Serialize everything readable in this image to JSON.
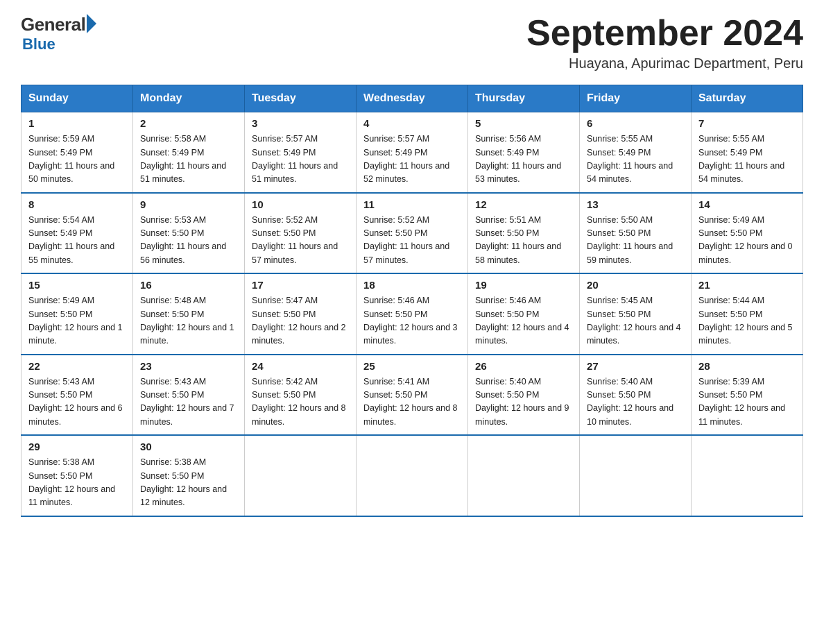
{
  "header": {
    "logo_general": "General",
    "logo_blue": "Blue",
    "month_title": "September 2024",
    "location": "Huayana, Apurimac Department, Peru"
  },
  "days_of_week": [
    "Sunday",
    "Monday",
    "Tuesday",
    "Wednesday",
    "Thursday",
    "Friday",
    "Saturday"
  ],
  "weeks": [
    [
      {
        "day": "1",
        "sunrise": "5:59 AM",
        "sunset": "5:49 PM",
        "daylight": "11 hours and 50 minutes."
      },
      {
        "day": "2",
        "sunrise": "5:58 AM",
        "sunset": "5:49 PM",
        "daylight": "11 hours and 51 minutes."
      },
      {
        "day": "3",
        "sunrise": "5:57 AM",
        "sunset": "5:49 PM",
        "daylight": "11 hours and 51 minutes."
      },
      {
        "day": "4",
        "sunrise": "5:57 AM",
        "sunset": "5:49 PM",
        "daylight": "11 hours and 52 minutes."
      },
      {
        "day": "5",
        "sunrise": "5:56 AM",
        "sunset": "5:49 PM",
        "daylight": "11 hours and 53 minutes."
      },
      {
        "day": "6",
        "sunrise": "5:55 AM",
        "sunset": "5:49 PM",
        "daylight": "11 hours and 54 minutes."
      },
      {
        "day": "7",
        "sunrise": "5:55 AM",
        "sunset": "5:49 PM",
        "daylight": "11 hours and 54 minutes."
      }
    ],
    [
      {
        "day": "8",
        "sunrise": "5:54 AM",
        "sunset": "5:49 PM",
        "daylight": "11 hours and 55 minutes."
      },
      {
        "day": "9",
        "sunrise": "5:53 AM",
        "sunset": "5:50 PM",
        "daylight": "11 hours and 56 minutes."
      },
      {
        "day": "10",
        "sunrise": "5:52 AM",
        "sunset": "5:50 PM",
        "daylight": "11 hours and 57 minutes."
      },
      {
        "day": "11",
        "sunrise": "5:52 AM",
        "sunset": "5:50 PM",
        "daylight": "11 hours and 57 minutes."
      },
      {
        "day": "12",
        "sunrise": "5:51 AM",
        "sunset": "5:50 PM",
        "daylight": "11 hours and 58 minutes."
      },
      {
        "day": "13",
        "sunrise": "5:50 AM",
        "sunset": "5:50 PM",
        "daylight": "11 hours and 59 minutes."
      },
      {
        "day": "14",
        "sunrise": "5:49 AM",
        "sunset": "5:50 PM",
        "daylight": "12 hours and 0 minutes."
      }
    ],
    [
      {
        "day": "15",
        "sunrise": "5:49 AM",
        "sunset": "5:50 PM",
        "daylight": "12 hours and 1 minute."
      },
      {
        "day": "16",
        "sunrise": "5:48 AM",
        "sunset": "5:50 PM",
        "daylight": "12 hours and 1 minute."
      },
      {
        "day": "17",
        "sunrise": "5:47 AM",
        "sunset": "5:50 PM",
        "daylight": "12 hours and 2 minutes."
      },
      {
        "day": "18",
        "sunrise": "5:46 AM",
        "sunset": "5:50 PM",
        "daylight": "12 hours and 3 minutes."
      },
      {
        "day": "19",
        "sunrise": "5:46 AM",
        "sunset": "5:50 PM",
        "daylight": "12 hours and 4 minutes."
      },
      {
        "day": "20",
        "sunrise": "5:45 AM",
        "sunset": "5:50 PM",
        "daylight": "12 hours and 4 minutes."
      },
      {
        "day": "21",
        "sunrise": "5:44 AM",
        "sunset": "5:50 PM",
        "daylight": "12 hours and 5 minutes."
      }
    ],
    [
      {
        "day": "22",
        "sunrise": "5:43 AM",
        "sunset": "5:50 PM",
        "daylight": "12 hours and 6 minutes."
      },
      {
        "day": "23",
        "sunrise": "5:43 AM",
        "sunset": "5:50 PM",
        "daylight": "12 hours and 7 minutes."
      },
      {
        "day": "24",
        "sunrise": "5:42 AM",
        "sunset": "5:50 PM",
        "daylight": "12 hours and 8 minutes."
      },
      {
        "day": "25",
        "sunrise": "5:41 AM",
        "sunset": "5:50 PM",
        "daylight": "12 hours and 8 minutes."
      },
      {
        "day": "26",
        "sunrise": "5:40 AM",
        "sunset": "5:50 PM",
        "daylight": "12 hours and 9 minutes."
      },
      {
        "day": "27",
        "sunrise": "5:40 AM",
        "sunset": "5:50 PM",
        "daylight": "12 hours and 10 minutes."
      },
      {
        "day": "28",
        "sunrise": "5:39 AM",
        "sunset": "5:50 PM",
        "daylight": "12 hours and 11 minutes."
      }
    ],
    [
      {
        "day": "29",
        "sunrise": "5:38 AM",
        "sunset": "5:50 PM",
        "daylight": "12 hours and 11 minutes."
      },
      {
        "day": "30",
        "sunrise": "5:38 AM",
        "sunset": "5:50 PM",
        "daylight": "12 hours and 12 minutes."
      },
      null,
      null,
      null,
      null,
      null
    ]
  ],
  "labels": {
    "sunrise": "Sunrise:",
    "sunset": "Sunset:",
    "daylight": "Daylight:"
  }
}
